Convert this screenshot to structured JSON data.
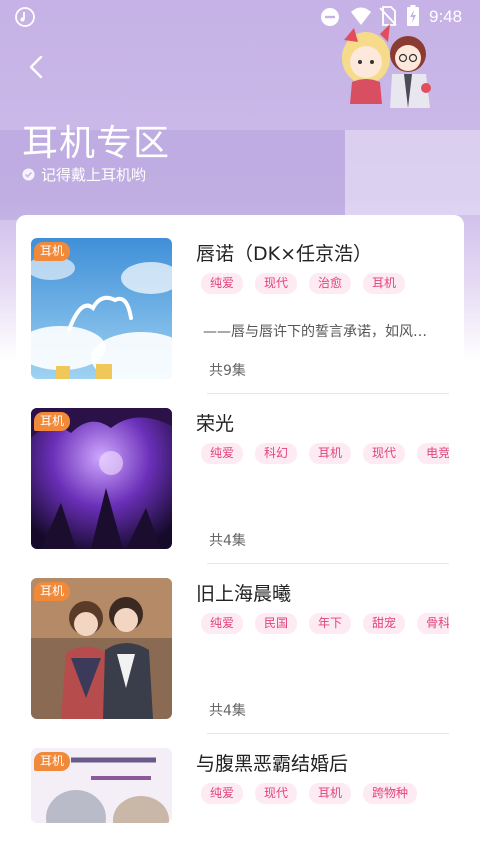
{
  "statusbar": {
    "time": "9:48"
  },
  "header": {
    "title": "耳机专区",
    "subtitle": "记得戴上耳机哟"
  },
  "colors": {
    "header_purple": "#c6b2e6",
    "badge_orange": "#f08a3a",
    "tag_bg": "#fdeaf2",
    "tag_text": "#e0457b"
  },
  "items": [
    {
      "badge": "耳机",
      "title": "唇诺（DK×任京浩）",
      "tags": [
        "纯爱",
        "现代",
        "治愈",
        "耳机"
      ],
      "desc": "——唇与唇许下的誓言承诺，如风…",
      "count": "共9集"
    },
    {
      "badge": "耳机",
      "title": "荣光",
      "tags": [
        "纯爱",
        "科幻",
        "耳机",
        "现代",
        "电竞"
      ],
      "desc": "",
      "count": "共4集"
    },
    {
      "badge": "耳机",
      "title": "旧上海晨曦",
      "tags": [
        "纯爱",
        "民国",
        "年下",
        "甜宠",
        "骨科"
      ],
      "desc": "",
      "count": "共4集"
    },
    {
      "badge": "耳机",
      "title": "与腹黑恶霸结婚后",
      "tags": [
        "纯爱",
        "现代",
        "耳机",
        "跨物种"
      ],
      "desc": "",
      "count": ""
    }
  ]
}
